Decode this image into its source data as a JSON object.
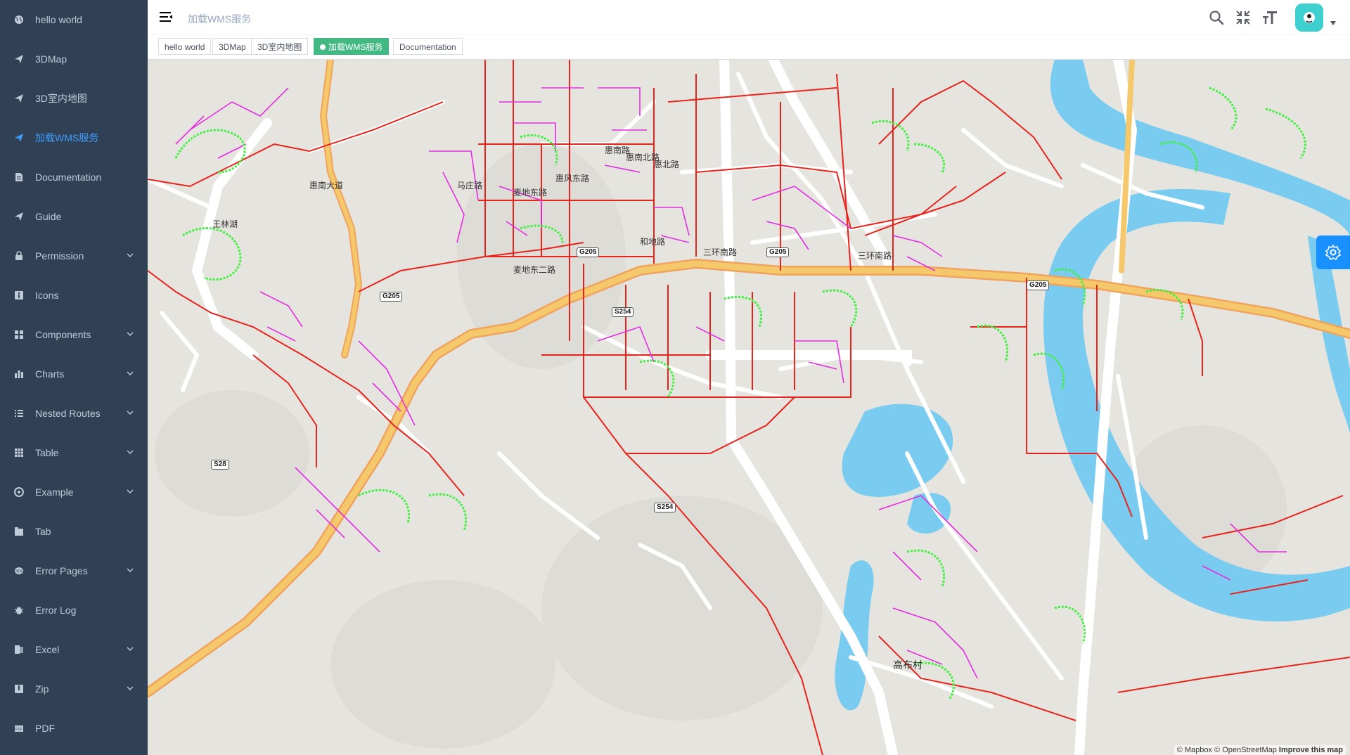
{
  "sidebar": {
    "items": [
      {
        "label": "hello world",
        "icon": "globe-icon",
        "expandable": false,
        "active": false
      },
      {
        "label": "3DMap",
        "icon": "paper-plane-icon",
        "expandable": false,
        "active": false
      },
      {
        "label": "3D室内地图",
        "icon": "paper-plane-icon",
        "expandable": false,
        "active": false
      },
      {
        "label": "加载WMS服务",
        "icon": "paper-plane-icon",
        "expandable": false,
        "active": true
      },
      {
        "label": "Documentation",
        "icon": "document-icon",
        "expandable": false,
        "active": false
      },
      {
        "label": "Guide",
        "icon": "paper-plane-icon",
        "expandable": false,
        "active": false
      },
      {
        "label": "Permission",
        "icon": "lock-icon",
        "expandable": true,
        "active": false
      },
      {
        "label": "Icons",
        "icon": "info-icon",
        "expandable": false,
        "active": false
      },
      {
        "label": "Components",
        "icon": "grid-icon",
        "expandable": true,
        "active": false
      },
      {
        "label": "Charts",
        "icon": "bar-chart-icon",
        "expandable": true,
        "active": false
      },
      {
        "label": "Nested Routes",
        "icon": "list-icon",
        "expandable": true,
        "active": false
      },
      {
        "label": "Table",
        "icon": "table-icon",
        "expandable": true,
        "active": false
      },
      {
        "label": "Example",
        "icon": "compass-icon",
        "expandable": true,
        "active": false
      },
      {
        "label": "Tab",
        "icon": "tab-icon",
        "expandable": false,
        "active": false
      },
      {
        "label": "Error Pages",
        "icon": "error-icon",
        "expandable": true,
        "active": false
      },
      {
        "label": "Error Log",
        "icon": "bug-icon",
        "expandable": false,
        "active": false
      },
      {
        "label": "Excel",
        "icon": "excel-icon",
        "expandable": true,
        "active": false
      },
      {
        "label": "Zip",
        "icon": "zip-icon",
        "expandable": true,
        "active": false
      },
      {
        "label": "PDF",
        "icon": "pdf-icon",
        "expandable": false,
        "active": false
      }
    ]
  },
  "navbar": {
    "breadcrumb": "加载WMS服务",
    "icons": [
      "search-icon",
      "fullscreen-exit-icon",
      "font-size-icon"
    ]
  },
  "tags": [
    {
      "label": "hello world",
      "active": false
    },
    {
      "label": "3DMap",
      "active": false
    },
    {
      "label": "3D室内地图",
      "active": false
    },
    {
      "label": "加载WMS服务",
      "active": true
    },
    {
      "label": "Documentation",
      "active": false
    }
  ],
  "map": {
    "place_labels": [
      "高布村",
      "王林湖",
      "麦地东路",
      "麦地东二路",
      "和地路",
      "惠南路",
      "马庄路",
      "惠南大道",
      "惠南北路",
      "惠风东路",
      "惠北路",
      "三环南路",
      "三环南路"
    ],
    "road_shields": [
      "G205",
      "G205",
      "G205",
      "S254",
      "S254",
      "G205",
      "S28"
    ],
    "attribution": {
      "text": "© Mapbox © OpenStreetMap",
      "improve": "Improve this map"
    },
    "colors": {
      "sewer": "#e8231b",
      "branch": "#e32ee0",
      "household": "#3ff03f",
      "water": "#79ccf0",
      "highway": "#f5c96b"
    }
  }
}
